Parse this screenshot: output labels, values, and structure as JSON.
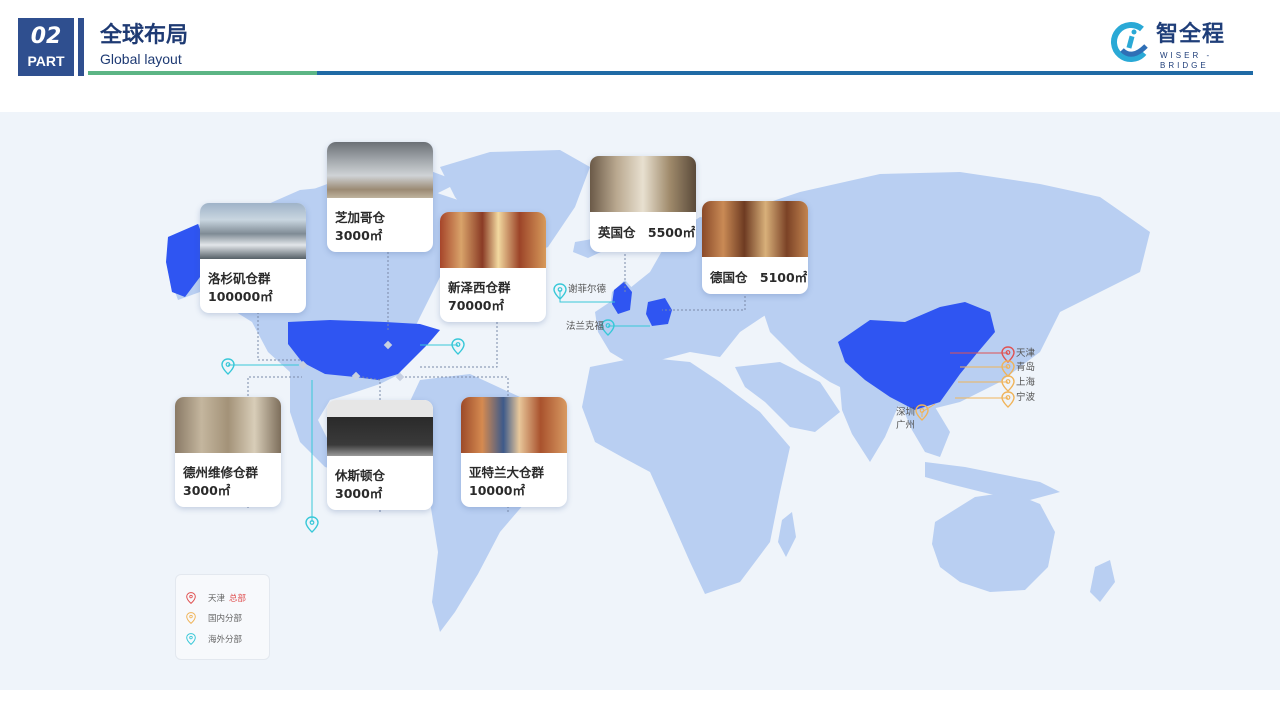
{
  "header": {
    "part_number": "02",
    "part_label": "PART",
    "title": "全球布局",
    "subtitle": "Global layout"
  },
  "logo": {
    "name_cn": "智全程",
    "name_en": "WISER - BRIDGE"
  },
  "warehouses": [
    {
      "name": "洛杉矶仓群",
      "area": "100000㎡"
    },
    {
      "name": "芝加哥仓",
      "area": "3000㎡"
    },
    {
      "name": "新泽西仓群",
      "area": "70000㎡"
    },
    {
      "name": "英国仓",
      "area": "5500㎡"
    },
    {
      "name": "德国仓",
      "area": "5100㎡"
    },
    {
      "name": "德州维修仓群",
      "area": "3000㎡"
    },
    {
      "name": "休斯顿仓",
      "area": "3000㎡"
    },
    {
      "name": "亚特兰大仓群",
      "area": "10000㎡"
    }
  ],
  "overseas_branches": [
    "谢菲尔德",
    "法兰克福"
  ],
  "china_branches": {
    "hq": "天津",
    "others": [
      "青岛",
      "上海",
      "宁波",
      "深圳",
      "广州"
    ]
  },
  "legend": {
    "hq_city": "天津",
    "hq_tag": "总部",
    "domestic": "国内分部",
    "overseas": "海外分部"
  },
  "colors": {
    "accent_blue": "#2f4f8f",
    "highlight_country": "#2f55f2",
    "map_land": "#b9cff2",
    "hq_pin": "#e05252",
    "domestic_pin": "#f0b45a",
    "overseas_pin": "#38c8d8"
  }
}
